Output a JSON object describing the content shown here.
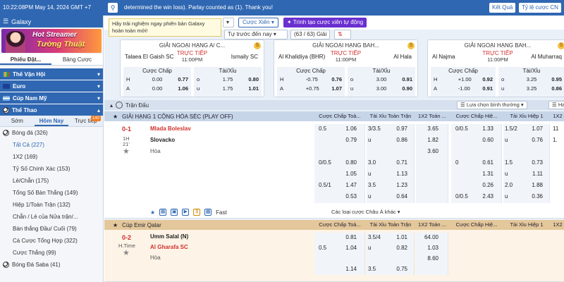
{
  "topbar": {
    "datetime": "10:22:08PM May 14, 2024 GMT +7",
    "search_icon": "search-icon",
    "marquee": "determined the win loss). Parlay counted as (1). Thank you!",
    "results_btn": "Kết Quả",
    "odds_ratio_btn": "Tỷ lệ cược CN"
  },
  "sidebar": {
    "header": "Galaxy",
    "banner_line1": "Hot Streamer",
    "banner_line2": "Tường Thuật",
    "tabs": [
      "Phiếu Đặt...",
      "Bảng Cược"
    ],
    "sections": [
      {
        "label": "Thế Vận Hội"
      },
      {
        "label": "Euro"
      },
      {
        "label": "Cúp Nam Mỹ"
      },
      {
        "label": "Thể Thao"
      }
    ],
    "subtabs": [
      "Sớm",
      "Hôm Nay",
      "Trực tiếp"
    ],
    "live_count": "140",
    "sport_main": "Bóng đá (326)",
    "items": [
      "Tất Cả (227)",
      "1X2 (169)",
      "Tỷ Số Chính Xác (153)",
      "Lẻ/Chẵn (175)",
      "Tổng Số Bàn Thắng (149)",
      "Hiệp 1/Toàn Trận (132)",
      "Chẵn / Lẻ của Nửa trận/...",
      "Bàn thắng Đầu/ Cuối (79)",
      "Cá Cược Tổng Hợp (322)",
      "Cược Thắng (99)"
    ],
    "sport_saba": "Bóng Đá Saba (41)"
  },
  "toolbar": {
    "tooltip": "Hãy trải nghiệm ngay phiên bản Galaxy hoàn toàn mới!",
    "bet_btn": "Cược Xiên",
    "auto_bet_btn": "Trình tạo cược xiên tự động",
    "sort_select": "Tự trước đến nay",
    "count": "(63 / 63) Giải"
  },
  "cards": [
    {
      "league": "GIẢI NGOẠI HẠNG A/ C...",
      "home": "Talaea El Gaish SC",
      "away": "Ismaily SC",
      "live": "TRỰC TIẾP",
      "kickoff": "11:00PM",
      "hdp_label": "Cược Chấp",
      "ou_label": "Tài/Xỉu",
      "hdp": [
        [
          "H",
          "0.00",
          "0.77"
        ],
        [
          "A",
          "0.00",
          "1.06"
        ]
      ],
      "ou": [
        [
          "o",
          "1.75",
          "0.80"
        ],
        [
          "u",
          "1.75",
          "1.01"
        ]
      ]
    },
    {
      "league": "GIẢI NGOẠI HẠNG BAH...",
      "home": "Al Khalidiya (BHR)",
      "away": "Al Hala",
      "live": "TRỰC TIẾP",
      "kickoff": "11:00PM",
      "hdp_label": "Cược Chấp",
      "ou_label": "Tài/Xỉu",
      "hdp": [
        [
          "H",
          "-0.75",
          "0.76"
        ],
        [
          "A",
          "+0.75",
          "1.07"
        ]
      ],
      "ou": [
        [
          "o",
          "3.00",
          "0.91"
        ],
        [
          "u",
          "3.00",
          "0.90"
        ]
      ]
    },
    {
      "league": "GIẢI NGOẠI HẠNG BAH...",
      "home": "Al Najma",
      "away": "Al Muharraq",
      "live": "TRỰC TIẾP",
      "kickoff": "11:00PM",
      "hdp_label": "Cược Chấp",
      "ou_label": "Tài/Xỉu",
      "hdp": [
        [
          "H",
          "+1.00",
          "0.92"
        ],
        [
          "A",
          "-1.00",
          "0.91"
        ]
      ],
      "ou": [
        [
          "o",
          "3.25",
          "0.95"
        ],
        [
          "u",
          "3.25",
          "0.86"
        ]
      ]
    }
  ],
  "section": {
    "label": "Trận Đấu",
    "filter": "Lựa chọn bình thường",
    "half": "Hai Đ"
  },
  "columns": {
    "hdp_full": "Cược Chấp Toà...",
    "ou_full": "Tài Xỉu Toàn Trận",
    "x12_full": "1X2 Toàn ...",
    "hdp_half": "Cược Chấp Hiệ...",
    "ou_half": "Tài Xỉu Hiệp 1",
    "x12_half": "1X2"
  },
  "league1": {
    "name": "GIẢI HẠNG 1 CỘNG HÒA SÉC (PLAY OFF)",
    "score": "0-1",
    "period": "1H",
    "minute": "21'",
    "home": "Mlada Boleslav",
    "away": "Slovacko",
    "draw": "Hòa",
    "rows": [
      {
        "hdp_line": "0.5",
        "hdp_h": "1.06",
        "ou_line": "3/3.5",
        "ou_o": "0.97",
        "x12": "3.65",
        "hh_line": "0/0.5",
        "hh_h": "1.33",
        "oh_line": "1.5/2",
        "oh_o": "1.07",
        "x12h": "11"
      },
      {
        "hdp_line": "",
        "hdp_h": "0.79",
        "ou_line": "u",
        "ou_o": "0.86",
        "x12": "1.82",
        "hh_line": "",
        "hh_h": "0.60",
        "oh_line": "u",
        "oh_o": "0.76",
        "x12h": "1."
      },
      {
        "hdp_line": "",
        "hdp_h": "",
        "ou_line": "",
        "ou_o": "",
        "x12": "3.60",
        "hh_line": "",
        "hh_h": "",
        "oh_line": "",
        "oh_o": "",
        "x12h": ""
      },
      {
        "hdp_line": "0/0.5",
        "hdp_h": "0.80",
        "ou_line": "3.0",
        "ou_o": "0.71",
        "x12": "",
        "hh_line": "0",
        "hh_h": "0.61",
        "oh_line": "1.5",
        "oh_o": "0.73",
        "x12h": ""
      },
      {
        "hdp_line": "",
        "hdp_h": "1.05",
        "ou_line": "u",
        "ou_o": "1.13",
        "x12": "",
        "hh_line": "",
        "hh_h": "1.31",
        "oh_line": "u",
        "oh_o": "1.11",
        "x12h": ""
      },
      {
        "hdp_line": "0.5/1",
        "hdp_h": "1.47",
        "ou_line": "3.5",
        "ou_o": "1.23",
        "x12": "",
        "hh_line": "",
        "hh_h": "0.26",
        "oh_line": "2.0",
        "oh_o": "1.88",
        "x12h": ""
      },
      {
        "hdp_line": "",
        "hdp_h": "0.53",
        "ou_line": "u",
        "ou_o": "0.64",
        "x12": "",
        "hh_line": "0/0.5",
        "hh_h": "2.43",
        "oh_line": "u",
        "oh_o": "0.36",
        "x12h": ""
      }
    ],
    "fast": "Fast",
    "more": "Các loại cược Châu Á khác"
  },
  "league2": {
    "name": "Cúp Emir Qatar",
    "score": "0-2",
    "period": "H.Time",
    "home": "Umm Salal (N)",
    "away": "Al Gharafa SC",
    "draw": "Hòa",
    "rows": [
      {
        "hdp_line": "",
        "hdp_h": "0.81",
        "ou_line": "3.5/4",
        "ou_o": "1.01",
        "x12": "64.00"
      },
      {
        "hdp_line": "0.5",
        "hdp_h": "1.04",
        "ou_line": "u",
        "ou_o": "0.82",
        "x12": "1.03"
      },
      {
        "hdp_line": "",
        "hdp_h": "",
        "ou_line": "",
        "ou_o": "",
        "x12": "8.60"
      },
      {
        "hdp_line": "",
        "hdp_h": "1.14",
        "ou_line": "3.5",
        "ou_o": "0.75",
        "x12": ""
      }
    ]
  },
  "colors": {
    "brand": "#2f67b2",
    "live": "#d0312d",
    "panel": "#eaf0f8"
  }
}
